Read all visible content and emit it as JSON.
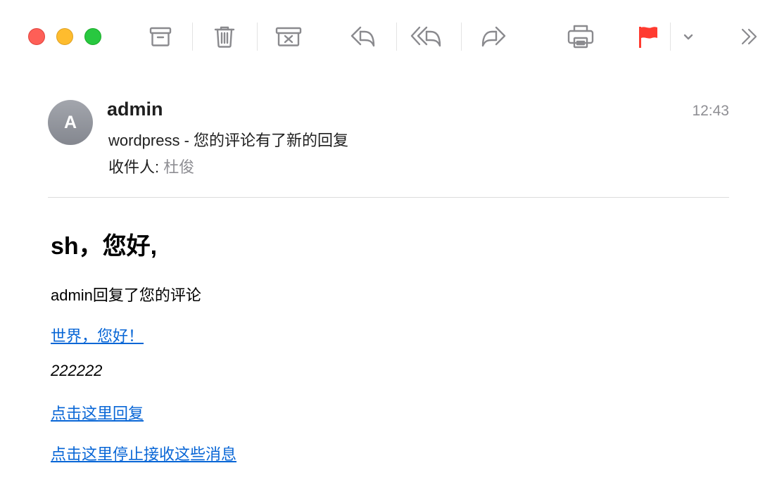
{
  "window": {
    "traffic_lights": [
      "close",
      "minimize",
      "zoom"
    ]
  },
  "toolbar": {
    "buttons": [
      {
        "name": "archive-icon"
      },
      {
        "name": "trash-icon"
      },
      {
        "name": "junk-icon"
      },
      {
        "name": "reply-icon"
      },
      {
        "name": "reply-all-icon"
      },
      {
        "name": "forward-icon"
      },
      {
        "name": "print-icon"
      },
      {
        "name": "flag-icon",
        "color": "#ff3b30"
      },
      {
        "name": "chevron-down-icon"
      },
      {
        "name": "more-icon"
      }
    ],
    "accent_icon_color": "#8a8a8e"
  },
  "message": {
    "avatar_initial": "A",
    "sender": "admin",
    "subject": "wordpress - 您的评论有了新的回复",
    "to_label": "收件人:",
    "to_value": "杜俊",
    "time": "12:43"
  },
  "body": {
    "greeting": "sh，您好,",
    "line1": "admin回复了您的评论",
    "link_post": "世界，您好！",
    "comment": "222222",
    "link_reply": "点击这里回复",
    "link_unsubscribe": "点击这里停止接收这些消息",
    "link_color": "#0866d6"
  }
}
